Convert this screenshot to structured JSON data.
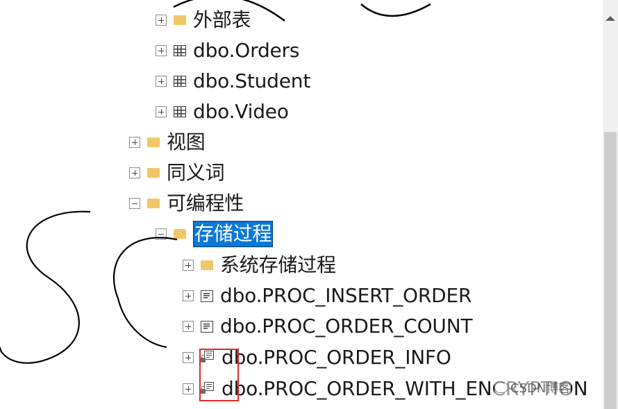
{
  "tree": {
    "nodes": [
      {
        "label": "外部表",
        "icon": "folder-icon",
        "expander": "plus"
      },
      {
        "label": "dbo.Orders",
        "icon": "table-icon",
        "expander": "plus"
      },
      {
        "label": "dbo.Student",
        "icon": "table-icon",
        "expander": "plus"
      },
      {
        "label": "dbo.Video",
        "icon": "table-icon",
        "expander": "plus"
      },
      {
        "label": "视图",
        "icon": "folder-icon",
        "expander": "plus"
      },
      {
        "label": "同义词",
        "icon": "folder-icon",
        "expander": "plus"
      },
      {
        "label": "可编程性",
        "icon": "folder-icon",
        "expander": "minus"
      },
      {
        "label": "存储过程",
        "icon": "folder-icon",
        "expander": "minus",
        "selected": true
      },
      {
        "label": "系统存储过程",
        "icon": "folder-icon",
        "expander": "plus"
      },
      {
        "label": "dbo.PROC_INSERT_ORDER",
        "icon": "stored-procedure-icon",
        "expander": "plus"
      },
      {
        "label": "dbo.PROC_ORDER_COUNT",
        "icon": "stored-procedure-icon",
        "expander": "plus"
      },
      {
        "label": "dbo.PROC_ORDER_INFO",
        "icon": "encrypted-procedure-icon",
        "expander": "plus"
      },
      {
        "label": "dbo.PROC_ORDER_WITH_ENCRYPTION",
        "icon": "encrypted-procedure-icon",
        "expander": "plus"
      }
    ]
  },
  "watermark": {
    "text": "CSDN博客"
  },
  "colors": {
    "selection": "#0a78d7",
    "folder": "#f0c667",
    "highlight_box": "#e02a2a"
  }
}
